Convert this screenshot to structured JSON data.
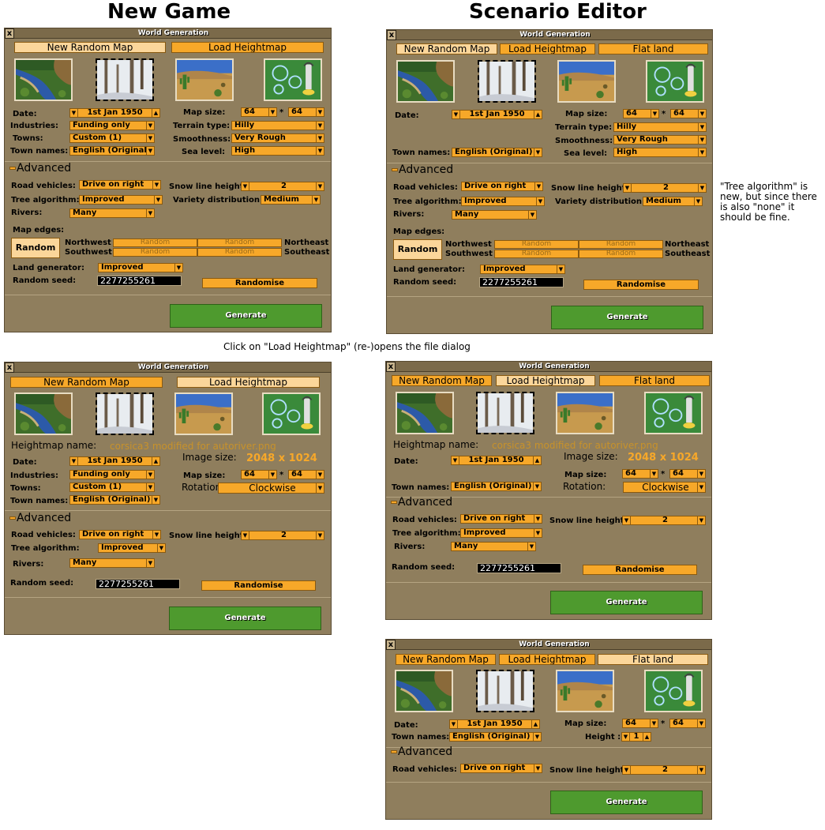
{
  "headings": {
    "new_game": "New Game",
    "scenario_editor": "Scenario Editor"
  },
  "caption": "Click on \"Load Heightmap\" (re-)opens the file dialog",
  "note": "\"Tree algorithm\" is new, but since there is also \"none\" it should be fine.",
  "window_title": "World Generation",
  "close_glyph": "x",
  "tabs": {
    "new_random_map": "New Random Map",
    "load_heightmap": "Load Heightmap",
    "flat_land": "Flat land"
  },
  "climates": [
    "temperate-climate-thumb",
    "sub-arctic-climate-thumb",
    "sub-tropical-climate-thumb",
    "toyland-climate-thumb"
  ],
  "labels": {
    "date": "Date:",
    "map_size": "Map size:",
    "industries": "Industries:",
    "terrain_type": "Terrain type:",
    "towns": "Towns:",
    "smoothness": "Smoothness:",
    "town_names": "Town names:",
    "sea_level": "Sea level:",
    "advanced": "Advanced",
    "road_vehicles": "Road vehicles:",
    "snow_line_height": "Snow line height:",
    "tree_algorithm": "Tree algorithm:",
    "variety_distribution": "Variety distribution:",
    "rivers": "Rivers:",
    "map_edges": "Map edges:",
    "northwest": "Northwest",
    "southwest": "Southwest",
    "northeast": "Northeast",
    "southeast": "Southeast",
    "land_generator": "Land generator:",
    "random_seed": "Random seed:",
    "heightmap_name": "Heightmap name:",
    "image_size": "Image size:",
    "rotation": "Rotation:",
    "height": "Height :",
    "times": "*"
  },
  "values": {
    "date": "1st Jan 1950",
    "map_x": "64",
    "map_y": "64",
    "industries": "Funding only",
    "terrain_type": "Hilly",
    "towns": "Custom (1)",
    "smoothness": "Very Rough",
    "town_names": "English (Original)",
    "sea_level": "High",
    "road_vehicles": "Drive on right",
    "snow_line_height": "2",
    "tree_algorithm": "Improved",
    "variety_distribution": "Medium",
    "rivers": "Many",
    "map_edges_random": "Random",
    "edge_random": "Random",
    "land_generator": "Improved",
    "random_seed": "2277255261",
    "heightmap_name": "corsica3 modified for autoriver.png",
    "image_size": "2048 x 1024",
    "rotation": "Clockwise",
    "height": "1"
  },
  "buttons": {
    "randomise": "Randomise",
    "generate": "Generate"
  },
  "glyphs": {
    "down": "▼",
    "up": "▲"
  },
  "colors": {
    "window_bg": "#8f7e5d",
    "button_orange": "#f7a829",
    "generate_green": "#4e9a2e",
    "heightmap_name": "#c8922a"
  }
}
